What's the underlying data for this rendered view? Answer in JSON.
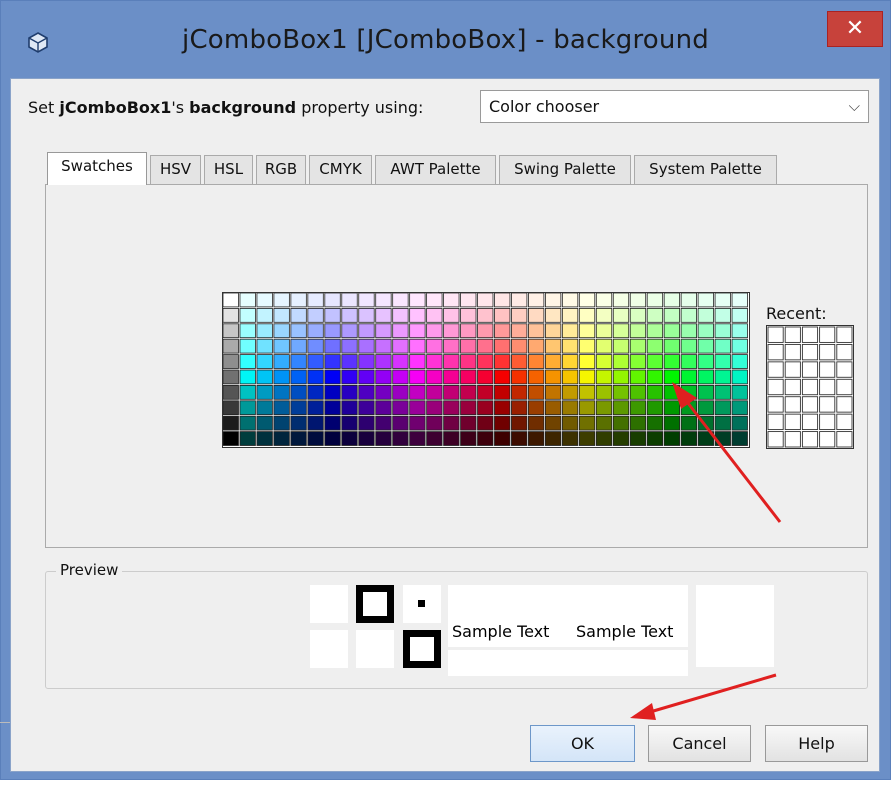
{
  "window": {
    "title": "jComboBox1 [JComboBox] - background",
    "close_glyph": "✕"
  },
  "property_row": {
    "prefix": "Set ",
    "component": "jComboBox1",
    "possessive": "'s ",
    "property": "background",
    "suffix": " property using:",
    "mode_value": "Color chooser"
  },
  "tabs": [
    {
      "label": "Swatches",
      "active": true
    },
    {
      "label": "HSV",
      "active": false
    },
    {
      "label": "HSL",
      "active": false
    },
    {
      "label": "RGB",
      "active": false
    },
    {
      "label": "CMYK",
      "active": false
    },
    {
      "label": "AWT Palette",
      "active": false
    },
    {
      "label": "Swing Palette",
      "active": false
    },
    {
      "label": "System Palette",
      "active": false
    }
  ],
  "swatches": {
    "recent_label": "Recent:"
  },
  "preview": {
    "label": "Preview",
    "sample_text": "Sample Text",
    "sample_text_2": "Sample Text"
  },
  "buttons": {
    "ok": "OK",
    "cancel": "Cancel",
    "help": "Help"
  },
  "colors": {
    "titlebar": "#6b8fc7",
    "close": "#c7423b",
    "annotation_arrow": "#e02020"
  },
  "icons": [
    "app-cube-icon",
    "close-icon",
    "chevron-down-icon",
    "annotation-arrow-icon"
  ]
}
